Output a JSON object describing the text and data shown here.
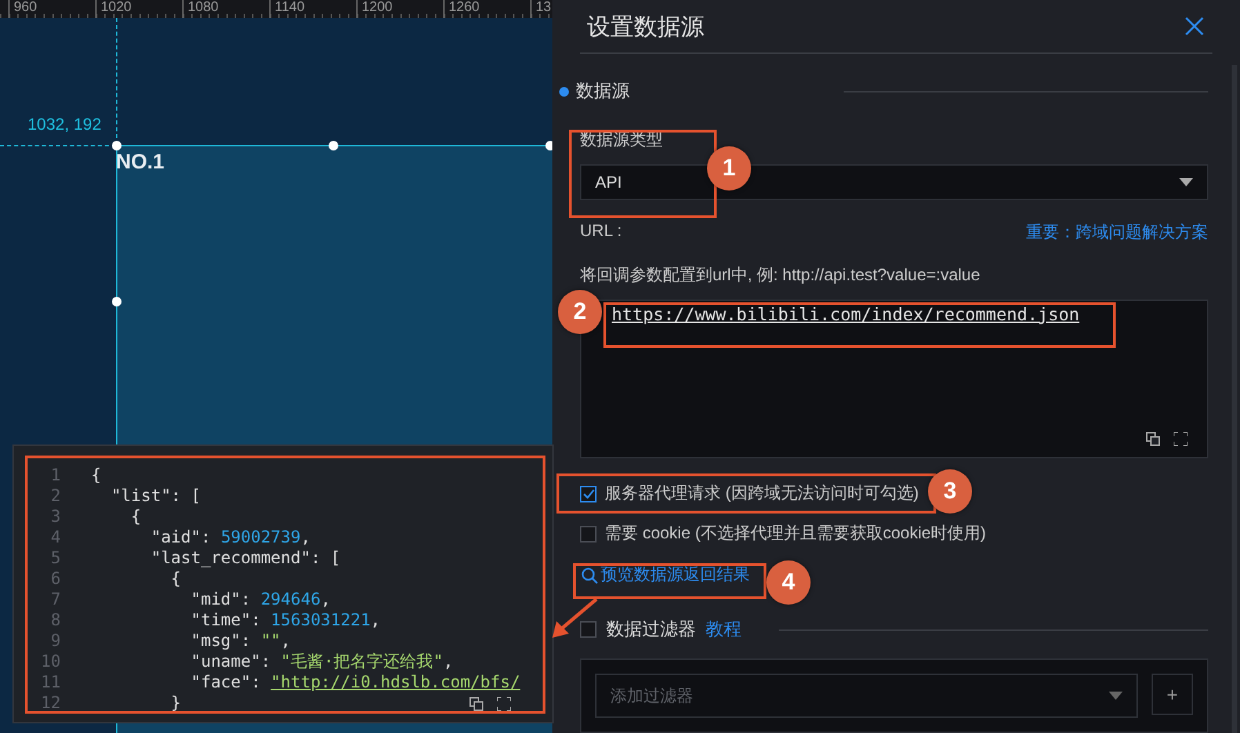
{
  "ruler": {
    "ticks": [
      "960",
      "1020",
      "1080",
      "1140",
      "1200",
      "1260",
      "13"
    ]
  },
  "canvas": {
    "coordinates": "1032, 192",
    "widget_title": "NO.1"
  },
  "panel": {
    "title": "设置数据源",
    "section": "数据源",
    "type_label": "数据源类型",
    "type_value": "API",
    "url_label": "URL :",
    "help_link": "重要：跨域问题解决方案",
    "hint": "将回调参数配置到url中, 例: http://api.test?value=:value",
    "url_value": "https://www.bilibili.com/index/recommend.json",
    "options": [
      {
        "label": "服务器代理请求 (因跨域无法访问时可勾选)",
        "checked": true
      },
      {
        "label": "需要 cookie (不选择代理并且需要获取cookie时使用)",
        "checked": false
      }
    ],
    "preview_link": "预览数据源返回结果",
    "filter": {
      "label": "数据过滤器",
      "checked": false,
      "tutorial_link": "教程",
      "placeholder": "添加过滤器",
      "add_button": "+"
    }
  },
  "preview": {
    "lines": [
      {
        "number": "1",
        "tokens": [
          {
            "kind": "punct",
            "text": "{"
          }
        ]
      },
      {
        "number": "2",
        "tokens": [
          {
            "kind": "key",
            "text": "  \"list\""
          },
          {
            "kind": "punct",
            "text": ": ["
          }
        ]
      },
      {
        "number": "3",
        "tokens": [
          {
            "kind": "punct",
            "text": "    {"
          }
        ]
      },
      {
        "number": "4",
        "tokens": [
          {
            "kind": "key",
            "text": "      \"aid\""
          },
          {
            "kind": "punct",
            "text": ": "
          },
          {
            "kind": "number",
            "text": "59002739"
          },
          {
            "kind": "punct",
            "text": ","
          }
        ]
      },
      {
        "number": "5",
        "tokens": [
          {
            "kind": "key",
            "text": "      \"last_recommend\""
          },
          {
            "kind": "punct",
            "text": ": ["
          }
        ]
      },
      {
        "number": "6",
        "tokens": [
          {
            "kind": "punct",
            "text": "        {"
          }
        ]
      },
      {
        "number": "7",
        "tokens": [
          {
            "kind": "key",
            "text": "          \"mid\""
          },
          {
            "kind": "punct",
            "text": ": "
          },
          {
            "kind": "number",
            "text": "294646"
          },
          {
            "kind": "punct",
            "text": ","
          }
        ]
      },
      {
        "number": "8",
        "tokens": [
          {
            "kind": "key",
            "text": "          \"time\""
          },
          {
            "kind": "punct",
            "text": ": "
          },
          {
            "kind": "number",
            "text": "1563031221"
          },
          {
            "kind": "punct",
            "text": ","
          }
        ]
      },
      {
        "number": "9",
        "tokens": [
          {
            "kind": "key",
            "text": "          \"msg\""
          },
          {
            "kind": "punct",
            "text": ": "
          },
          {
            "kind": "string",
            "text": "\"\""
          },
          {
            "kind": "punct",
            "text": ","
          }
        ]
      },
      {
        "number": "10",
        "tokens": [
          {
            "kind": "key",
            "text": "          \"uname\""
          },
          {
            "kind": "punct",
            "text": ": "
          },
          {
            "kind": "string",
            "text": "\"毛酱·把名字还给我\""
          },
          {
            "kind": "punct",
            "text": ","
          }
        ]
      },
      {
        "number": "11",
        "tokens": [
          {
            "kind": "key",
            "text": "          \"face\""
          },
          {
            "kind": "punct",
            "text": ": "
          },
          {
            "kind": "link",
            "text": "\"http://i0.hdslb.com/bfs/"
          }
        ]
      },
      {
        "number": "12",
        "tokens": [
          {
            "kind": "punct",
            "text": "        }"
          }
        ]
      }
    ]
  },
  "callouts": [
    "1",
    "2",
    "3",
    "4"
  ]
}
